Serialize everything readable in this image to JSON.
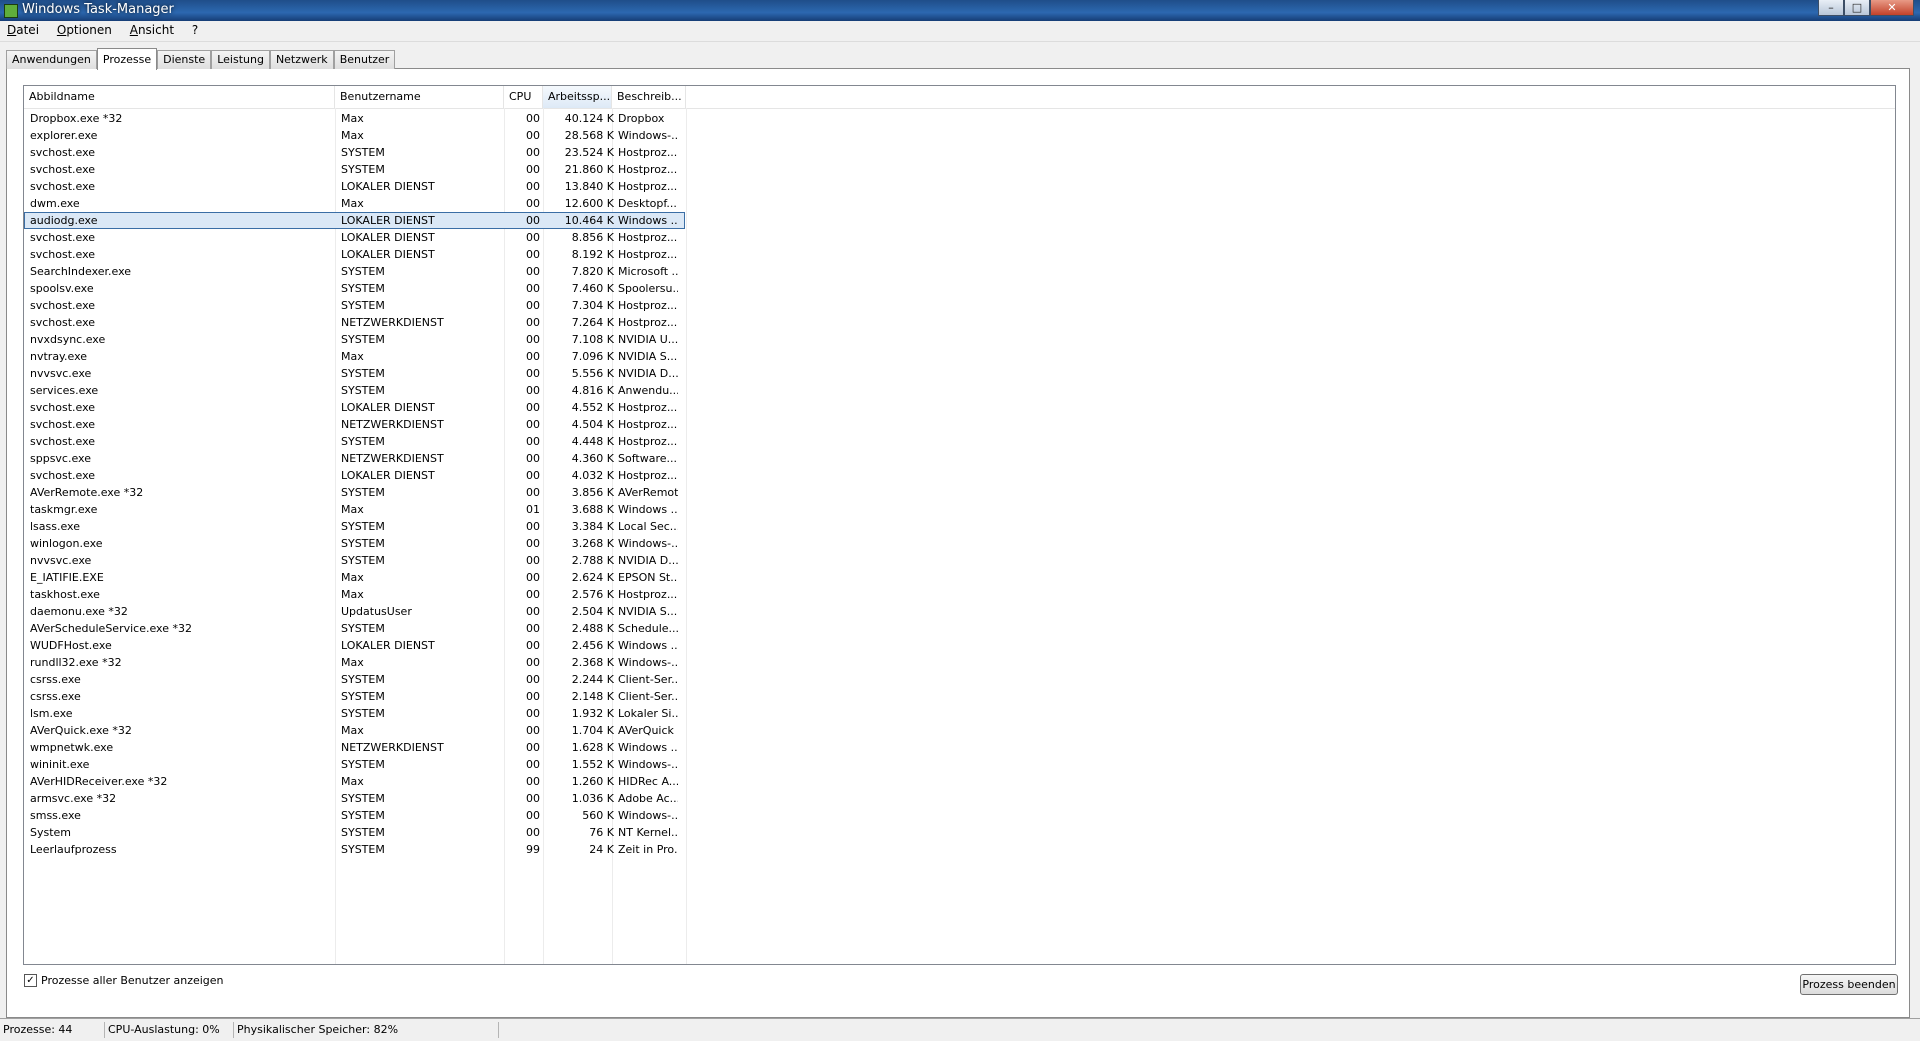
{
  "window": {
    "title": "Windows Task-Manager"
  },
  "menu": [
    "Datei",
    "Optionen",
    "Ansicht",
    "?"
  ],
  "tabs": [
    "Anwendungen",
    "Prozesse",
    "Dienste",
    "Leistung",
    "Netzwerk",
    "Benutzer"
  ],
  "active_tab": "Prozesse",
  "columns": {
    "name": "Abbildname",
    "user": "Benutzername",
    "cpu": "CPU",
    "mem": "Arbeitssp...",
    "desc": "Beschreib..."
  },
  "sorted_column": "mem",
  "selected_row": 6,
  "processes": [
    {
      "name": "Dropbox.exe *32",
      "user": "Max",
      "cpu": "00",
      "mem": "40.124 K",
      "desc": "Dropbox"
    },
    {
      "name": "explorer.exe",
      "user": "Max",
      "cpu": "00",
      "mem": "28.568 K",
      "desc": "Windows-..."
    },
    {
      "name": "svchost.exe",
      "user": "SYSTEM",
      "cpu": "00",
      "mem": "23.524 K",
      "desc": "Hostproz..."
    },
    {
      "name": "svchost.exe",
      "user": "SYSTEM",
      "cpu": "00",
      "mem": "21.860 K",
      "desc": "Hostproz..."
    },
    {
      "name": "svchost.exe",
      "user": "LOKALER DIENST",
      "cpu": "00",
      "mem": "13.840 K",
      "desc": "Hostproz..."
    },
    {
      "name": "dwm.exe",
      "user": "Max",
      "cpu": "00",
      "mem": "12.600 K",
      "desc": "Desktopf..."
    },
    {
      "name": "audiodg.exe",
      "user": "LOKALER DIENST",
      "cpu": "00",
      "mem": "10.464 K",
      "desc": "Windows ..."
    },
    {
      "name": "svchost.exe",
      "user": "LOKALER DIENST",
      "cpu": "00",
      "mem": "8.856 K",
      "desc": "Hostproz..."
    },
    {
      "name": "svchost.exe",
      "user": "LOKALER DIENST",
      "cpu": "00",
      "mem": "8.192 K",
      "desc": "Hostproz..."
    },
    {
      "name": "SearchIndexer.exe",
      "user": "SYSTEM",
      "cpu": "00",
      "mem": "7.820 K",
      "desc": "Microsoft ..."
    },
    {
      "name": "spoolsv.exe",
      "user": "SYSTEM",
      "cpu": "00",
      "mem": "7.460 K",
      "desc": "Spoolersu..."
    },
    {
      "name": "svchost.exe",
      "user": "SYSTEM",
      "cpu": "00",
      "mem": "7.304 K",
      "desc": "Hostproz..."
    },
    {
      "name": "svchost.exe",
      "user": "NETZWERKDIENST",
      "cpu": "00",
      "mem": "7.264 K",
      "desc": "Hostproz..."
    },
    {
      "name": "nvxdsync.exe",
      "user": "SYSTEM",
      "cpu": "00",
      "mem": "7.108 K",
      "desc": "NVIDIA U..."
    },
    {
      "name": "nvtray.exe",
      "user": "Max",
      "cpu": "00",
      "mem": "7.096 K",
      "desc": "NVIDIA S..."
    },
    {
      "name": "nvvsvc.exe",
      "user": "SYSTEM",
      "cpu": "00",
      "mem": "5.556 K",
      "desc": "NVIDIA D..."
    },
    {
      "name": "services.exe",
      "user": "SYSTEM",
      "cpu": "00",
      "mem": "4.816 K",
      "desc": "Anwendu..."
    },
    {
      "name": "svchost.exe",
      "user": "LOKALER DIENST",
      "cpu": "00",
      "mem": "4.552 K",
      "desc": "Hostproz..."
    },
    {
      "name": "svchost.exe",
      "user": "NETZWERKDIENST",
      "cpu": "00",
      "mem": "4.504 K",
      "desc": "Hostproz..."
    },
    {
      "name": "svchost.exe",
      "user": "SYSTEM",
      "cpu": "00",
      "mem": "4.448 K",
      "desc": "Hostproz..."
    },
    {
      "name": "sppsvc.exe",
      "user": "NETZWERKDIENST",
      "cpu": "00",
      "mem": "4.360 K",
      "desc": "Software..."
    },
    {
      "name": "svchost.exe",
      "user": "LOKALER DIENST",
      "cpu": "00",
      "mem": "4.032 K",
      "desc": "Hostproz..."
    },
    {
      "name": "AVerRemote.exe *32",
      "user": "SYSTEM",
      "cpu": "00",
      "mem": "3.856 K",
      "desc": "AVerRemote"
    },
    {
      "name": "taskmgr.exe",
      "user": "Max",
      "cpu": "01",
      "mem": "3.688 K",
      "desc": "Windows ..."
    },
    {
      "name": "lsass.exe",
      "user": "SYSTEM",
      "cpu": "00",
      "mem": "3.384 K",
      "desc": "Local Sec..."
    },
    {
      "name": "winlogon.exe",
      "user": "SYSTEM",
      "cpu": "00",
      "mem": "3.268 K",
      "desc": "Windows-..."
    },
    {
      "name": "nvvsvc.exe",
      "user": "SYSTEM",
      "cpu": "00",
      "mem": "2.788 K",
      "desc": "NVIDIA D..."
    },
    {
      "name": "E_IATIFIE.EXE",
      "user": "Max",
      "cpu": "00",
      "mem": "2.624 K",
      "desc": "EPSON St..."
    },
    {
      "name": "taskhost.exe",
      "user": "Max",
      "cpu": "00",
      "mem": "2.576 K",
      "desc": "Hostproz..."
    },
    {
      "name": "daemonu.exe *32",
      "user": "UpdatusUser",
      "cpu": "00",
      "mem": "2.504 K",
      "desc": "NVIDIA S..."
    },
    {
      "name": "AVerScheduleService.exe *32",
      "user": "SYSTEM",
      "cpu": "00",
      "mem": "2.488 K",
      "desc": "Schedule..."
    },
    {
      "name": "WUDFHost.exe",
      "user": "LOKALER DIENST",
      "cpu": "00",
      "mem": "2.456 K",
      "desc": "Windows ..."
    },
    {
      "name": "rundll32.exe *32",
      "user": "Max",
      "cpu": "00",
      "mem": "2.368 K",
      "desc": "Windows-..."
    },
    {
      "name": "csrss.exe",
      "user": "SYSTEM",
      "cpu": "00",
      "mem": "2.244 K",
      "desc": "Client-Ser..."
    },
    {
      "name": "csrss.exe",
      "user": "SYSTEM",
      "cpu": "00",
      "mem": "2.148 K",
      "desc": "Client-Ser..."
    },
    {
      "name": "lsm.exe",
      "user": "SYSTEM",
      "cpu": "00",
      "mem": "1.932 K",
      "desc": "Lokaler Si..."
    },
    {
      "name": "AVerQuick.exe *32",
      "user": "Max",
      "cpu": "00",
      "mem": "1.704 K",
      "desc": "AVerQuick"
    },
    {
      "name": "wmpnetwk.exe",
      "user": "NETZWERKDIENST",
      "cpu": "00",
      "mem": "1.628 K",
      "desc": "Windows ..."
    },
    {
      "name": "wininit.exe",
      "user": "SYSTEM",
      "cpu": "00",
      "mem": "1.552 K",
      "desc": "Windows-..."
    },
    {
      "name": "AVerHIDReceiver.exe *32",
      "user": "Max",
      "cpu": "00",
      "mem": "1.260 K",
      "desc": "HIDRec A..."
    },
    {
      "name": "armsvc.exe *32",
      "user": "SYSTEM",
      "cpu": "00",
      "mem": "1.036 K",
      "desc": "Adobe Ac..."
    },
    {
      "name": "smss.exe",
      "user": "SYSTEM",
      "cpu": "00",
      "mem": "560 K",
      "desc": "Windows-..."
    },
    {
      "name": "System",
      "user": "SYSTEM",
      "cpu": "00",
      "mem": "76 K",
      "desc": "NT Kernel..."
    },
    {
      "name": "Leerlaufprozess",
      "user": "SYSTEM",
      "cpu": "99",
      "mem": "24 K",
      "desc": "Zeit in Pro..."
    }
  ],
  "footer": {
    "show_all_label": "Prozesse aller Benutzer anzeigen",
    "show_all_checked": true,
    "end_process_label": "Prozess beenden"
  },
  "status": {
    "processes": "Prozesse: 44",
    "cpu": "CPU-Auslastung: 0%",
    "memory": "Physikalischer Speicher: 82%"
  },
  "icons": {
    "app": "task-manager-icon",
    "minimize": "minimize-icon",
    "maximize": "maximize-icon",
    "close": "close-icon",
    "checkmark": "checkmark-icon"
  }
}
